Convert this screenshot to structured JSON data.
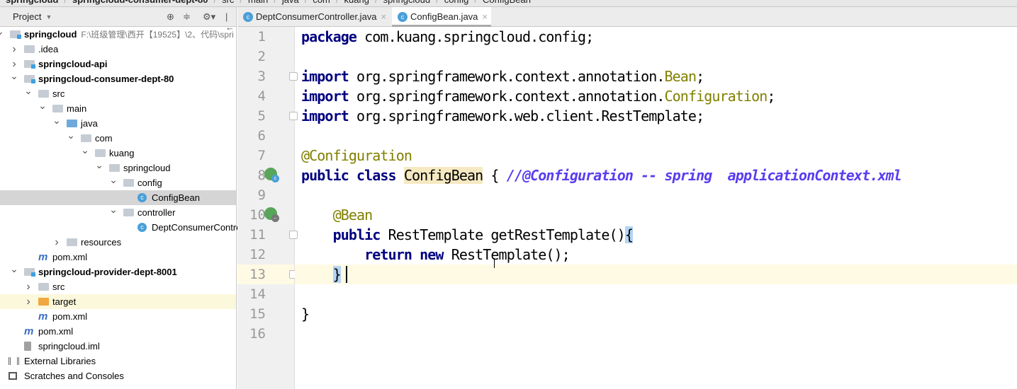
{
  "breadcrumb": [
    {
      "label": "springcloud",
      "bold": true
    },
    {
      "label": "springcloud-consumer-dept-80",
      "bold": true
    },
    {
      "label": "src"
    },
    {
      "label": "main"
    },
    {
      "label": "java"
    },
    {
      "label": "com"
    },
    {
      "label": "kuang"
    },
    {
      "label": "springcloud"
    },
    {
      "label": "config"
    },
    {
      "label": "ConfigBean"
    }
  ],
  "project_panel": {
    "title": "Project",
    "dropdown_icon": "chevron-down-icon",
    "toolbar_icons": [
      "locate-icon",
      "collapse-all-icon",
      "gear-icon",
      "hide-icon"
    ]
  },
  "tree": [
    {
      "label": "springcloud",
      "bold": true,
      "path": "F:\\班级管理\\西开【19525】\\2、代码\\spri",
      "level": 0,
      "arrow": "down",
      "icon": "module"
    },
    {
      "label": ".idea",
      "level": 1,
      "arrow": "right",
      "icon": "folder"
    },
    {
      "label": "springcloud-api",
      "bold": true,
      "level": 1,
      "arrow": "right",
      "icon": "module"
    },
    {
      "label": "springcloud-consumer-dept-80",
      "bold": true,
      "level": 1,
      "arrow": "down",
      "icon": "module"
    },
    {
      "label": "src",
      "level": 2,
      "arrow": "down",
      "icon": "folder"
    },
    {
      "label": "main",
      "level": 3,
      "arrow": "down",
      "icon": "folder"
    },
    {
      "label": "java",
      "level": 4,
      "arrow": "down",
      "icon": "blue"
    },
    {
      "label": "com",
      "level": 5,
      "arrow": "down",
      "icon": "folder"
    },
    {
      "label": "kuang",
      "level": 6,
      "arrow": "down",
      "icon": "folder"
    },
    {
      "label": "springcloud",
      "level": 7,
      "arrow": "down",
      "icon": "folder"
    },
    {
      "label": "config",
      "level": 8,
      "arrow": "down",
      "icon": "folder"
    },
    {
      "label": "ConfigBean",
      "level": 9,
      "icon": "class",
      "selected": true
    },
    {
      "label": "controller",
      "level": 8,
      "arrow": "down",
      "icon": "folder"
    },
    {
      "label": "DeptConsumerController",
      "level": 9,
      "icon": "class"
    },
    {
      "label": "resources",
      "level": 4,
      "arrow": "right",
      "icon": "folder"
    },
    {
      "label": "pom.xml",
      "level": 2,
      "icon": "maven"
    },
    {
      "label": "springcloud-provider-dept-8001",
      "bold": true,
      "level": 1,
      "arrow": "down",
      "icon": "module"
    },
    {
      "label": "src",
      "level": 2,
      "arrow": "right",
      "icon": "folder"
    },
    {
      "label": "target",
      "level": 2,
      "arrow": "right",
      "icon": "orange",
      "highlight": true
    },
    {
      "label": "pom.xml",
      "level": 2,
      "icon": "maven"
    },
    {
      "label": "pom.xml",
      "level": 1,
      "icon": "maven"
    },
    {
      "label": "springcloud.iml",
      "level": 1,
      "icon": "file"
    },
    {
      "label": "External Libraries",
      "level": 0,
      "icon": "library"
    },
    {
      "label": "Scratches and Consoles",
      "level": 0,
      "icon": "scratch"
    }
  ],
  "tabs": [
    {
      "label": "DeptConsumerController.java",
      "active": false
    },
    {
      "label": "ConfigBean.java",
      "active": true
    }
  ],
  "code": [
    [
      [
        "package",
        "kw"
      ],
      [
        " com.kuang.springcloud.config;",
        ""
      ]
    ],
    [],
    [
      [
        "import",
        "kw"
      ],
      [
        " org.springframework.context.annotation.",
        ""
      ],
      [
        "Bean",
        "an"
      ],
      [
        ";",
        ""
      ]
    ],
    [
      [
        "import",
        "kw"
      ],
      [
        " org.springframework.context.annotation.",
        ""
      ],
      [
        "Configuration",
        "an"
      ],
      [
        ";",
        ""
      ]
    ],
    [
      [
        "import",
        "kw"
      ],
      [
        " org.springframework.web.client.RestTemplate;",
        ""
      ]
    ],
    [],
    [
      [
        "@Configuration",
        "an"
      ]
    ],
    [
      [
        "public class",
        "kw"
      ],
      [
        " ",
        ""
      ],
      [
        "ConfigBean",
        "hlw"
      ],
      [
        " { ",
        ""
      ],
      [
        "//@Configuration -- spring  applicationContext.xml",
        "cm"
      ]
    ],
    [],
    [
      [
        "    ",
        ""
      ],
      [
        "@Bean",
        "an"
      ]
    ],
    [
      [
        "    ",
        ""
      ],
      [
        "public",
        "kw"
      ],
      [
        " RestTemplate getRestTemplate()",
        ""
      ],
      [
        "{",
        "br"
      ]
    ],
    [
      [
        "        ",
        ""
      ],
      [
        "return new",
        "kw"
      ],
      [
        " RestTemplate();",
        ""
      ]
    ],
    [
      [
        "    ",
        ""
      ],
      [
        "}",
        "br"
      ]
    ],
    [],
    [
      [
        "}",
        ""
      ]
    ],
    []
  ],
  "current_line": 13
}
